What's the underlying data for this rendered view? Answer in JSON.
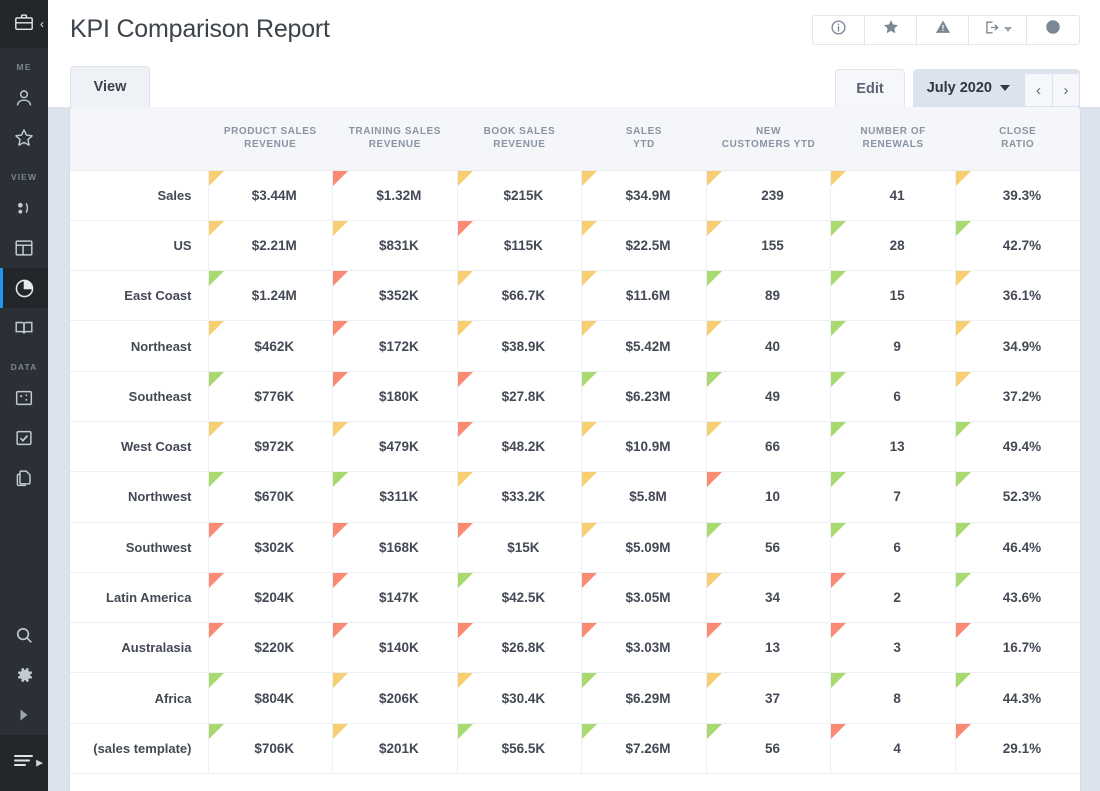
{
  "sidebar": {
    "logo_icon": "briefcase-icon",
    "collapse_icon": "chevron-left-icon",
    "sections": [
      {
        "label": "ME",
        "items": [
          {
            "icon": "user-icon",
            "name": "sidebar-item-profile"
          },
          {
            "icon": "star-icon",
            "name": "sidebar-item-favorites"
          }
        ]
      },
      {
        "label": "VIEW",
        "items": [
          {
            "icon": "people-icon",
            "name": "sidebar-item-people"
          },
          {
            "icon": "dashboard-icon",
            "name": "sidebar-item-dashboard"
          },
          {
            "icon": "pie-chart-icon",
            "name": "sidebar-item-reports",
            "active": true
          },
          {
            "icon": "book-icon",
            "name": "sidebar-item-library"
          }
        ]
      },
      {
        "label": "DATA",
        "items": [
          {
            "icon": "grid-dots-icon",
            "name": "sidebar-item-datasets"
          },
          {
            "icon": "checkbox-icon",
            "name": "sidebar-item-tasks"
          },
          {
            "icon": "copy-icon",
            "name": "sidebar-item-files"
          }
        ]
      }
    ],
    "footer_items": [
      {
        "icon": "search-icon",
        "name": "sidebar-item-search"
      },
      {
        "icon": "gear-icon",
        "name": "sidebar-item-settings"
      },
      {
        "icon": "play-icon",
        "name": "sidebar-item-expand"
      }
    ],
    "bottom_bar": {
      "icon": "menu-lines-icon",
      "arrow_icon": "triangle-right-icon"
    }
  },
  "header": {
    "title": "KPI Comparison Report",
    "toolbar": [
      {
        "name": "info-icon",
        "label": "Info"
      },
      {
        "name": "star-icon",
        "label": "Favorite"
      },
      {
        "name": "warning-icon",
        "label": "Alerts"
      },
      {
        "name": "export-icon",
        "label": "Export",
        "has_caret": true
      },
      {
        "name": "clock-icon",
        "label": "History"
      }
    ]
  },
  "tabs": {
    "view_label": "View",
    "edit_label": "Edit",
    "period_label": "July 2020",
    "prev_label": "‹",
    "next_label": "›"
  },
  "table": {
    "row_header_label": "",
    "columns": [
      "PRODUCT SALES REVENUE",
      "TRAINING SALES REVENUE",
      "BOOK SALES REVENUE",
      "SALES YTD",
      "NEW CUSTOMERS YTD",
      "NUMBER OF RENEWALS",
      "CLOSE RATIO"
    ],
    "column_lines": [
      [
        "PRODUCT SALES",
        "REVENUE"
      ],
      [
        "TRAINING SALES",
        "REVENUE"
      ],
      [
        "BOOK SALES",
        "REVENUE"
      ],
      [
        "SALES",
        "YTD"
      ],
      [
        "NEW",
        "CUSTOMERS YTD"
      ],
      [
        "NUMBER OF",
        "RENEWALS"
      ],
      [
        "CLOSE",
        "RATIO"
      ]
    ],
    "rows": [
      {
        "label": "Sales",
        "cells": [
          {
            "value": "$3.44M",
            "status": "yellow"
          },
          {
            "value": "$1.32M",
            "status": "red"
          },
          {
            "value": "$215K",
            "status": "yellow"
          },
          {
            "value": "$34.9M",
            "status": "yellow"
          },
          {
            "value": "239",
            "status": "yellow"
          },
          {
            "value": "41",
            "status": "yellow"
          },
          {
            "value": "39.3%",
            "status": "yellow"
          }
        ]
      },
      {
        "label": "US",
        "cells": [
          {
            "value": "$2.21M",
            "status": "yellow"
          },
          {
            "value": "$831K",
            "status": "yellow"
          },
          {
            "value": "$115K",
            "status": "red"
          },
          {
            "value": "$22.5M",
            "status": "yellow"
          },
          {
            "value": "155",
            "status": "yellow"
          },
          {
            "value": "28",
            "status": "green"
          },
          {
            "value": "42.7%",
            "status": "green"
          }
        ]
      },
      {
        "label": "East Coast",
        "cells": [
          {
            "value": "$1.24M",
            "status": "green"
          },
          {
            "value": "$352K",
            "status": "red"
          },
          {
            "value": "$66.7K",
            "status": "yellow"
          },
          {
            "value": "$11.6M",
            "status": "yellow"
          },
          {
            "value": "89",
            "status": "green"
          },
          {
            "value": "15",
            "status": "green"
          },
          {
            "value": "36.1%",
            "status": "yellow"
          }
        ]
      },
      {
        "label": "Northeast",
        "cells": [
          {
            "value": "$462K",
            "status": "yellow"
          },
          {
            "value": "$172K",
            "status": "red"
          },
          {
            "value": "$38.9K",
            "status": "yellow"
          },
          {
            "value": "$5.42M",
            "status": "yellow"
          },
          {
            "value": "40",
            "status": "yellow"
          },
          {
            "value": "9",
            "status": "green"
          },
          {
            "value": "34.9%",
            "status": "yellow"
          }
        ]
      },
      {
        "label": "Southeast",
        "cells": [
          {
            "value": "$776K",
            "status": "green"
          },
          {
            "value": "$180K",
            "status": "red"
          },
          {
            "value": "$27.8K",
            "status": "red"
          },
          {
            "value": "$6.23M",
            "status": "green"
          },
          {
            "value": "49",
            "status": "green"
          },
          {
            "value": "6",
            "status": "green"
          },
          {
            "value": "37.2%",
            "status": "yellow"
          }
        ]
      },
      {
        "label": "West Coast",
        "cells": [
          {
            "value": "$972K",
            "status": "yellow"
          },
          {
            "value": "$479K",
            "status": "yellow"
          },
          {
            "value": "$48.2K",
            "status": "red"
          },
          {
            "value": "$10.9M",
            "status": "yellow"
          },
          {
            "value": "66",
            "status": "yellow"
          },
          {
            "value": "13",
            "status": "green"
          },
          {
            "value": "49.4%",
            "status": "green"
          }
        ]
      },
      {
        "label": "Northwest",
        "cells": [
          {
            "value": "$670K",
            "status": "green"
          },
          {
            "value": "$311K",
            "status": "green"
          },
          {
            "value": "$33.2K",
            "status": "yellow"
          },
          {
            "value": "$5.8M",
            "status": "yellow"
          },
          {
            "value": "10",
            "status": "red"
          },
          {
            "value": "7",
            "status": "green"
          },
          {
            "value": "52.3%",
            "status": "green"
          }
        ]
      },
      {
        "label": "Southwest",
        "cells": [
          {
            "value": "$302K",
            "status": "red"
          },
          {
            "value": "$168K",
            "status": "red"
          },
          {
            "value": "$15K",
            "status": "red"
          },
          {
            "value": "$5.09M",
            "status": "yellow"
          },
          {
            "value": "56",
            "status": "green"
          },
          {
            "value": "6",
            "status": "green"
          },
          {
            "value": "46.4%",
            "status": "green"
          }
        ]
      },
      {
        "label": "Latin America",
        "cells": [
          {
            "value": "$204K",
            "status": "red"
          },
          {
            "value": "$147K",
            "status": "red"
          },
          {
            "value": "$42.5K",
            "status": "green"
          },
          {
            "value": "$3.05M",
            "status": "red"
          },
          {
            "value": "34",
            "status": "yellow"
          },
          {
            "value": "2",
            "status": "red"
          },
          {
            "value": "43.6%",
            "status": "green"
          }
        ]
      },
      {
        "label": "Australasia",
        "cells": [
          {
            "value": "$220K",
            "status": "red"
          },
          {
            "value": "$140K",
            "status": "red"
          },
          {
            "value": "$26.8K",
            "status": "red"
          },
          {
            "value": "$3.03M",
            "status": "red"
          },
          {
            "value": "13",
            "status": "red"
          },
          {
            "value": "3",
            "status": "red"
          },
          {
            "value": "16.7%",
            "status": "red"
          }
        ]
      },
      {
        "label": "Africa",
        "cells": [
          {
            "value": "$804K",
            "status": "green"
          },
          {
            "value": "$206K",
            "status": "yellow"
          },
          {
            "value": "$30.4K",
            "status": "yellow"
          },
          {
            "value": "$6.29M",
            "status": "green"
          },
          {
            "value": "37",
            "status": "yellow"
          },
          {
            "value": "8",
            "status": "green"
          },
          {
            "value": "44.3%",
            "status": "green"
          }
        ]
      },
      {
        "label": "(sales template)",
        "cells": [
          {
            "value": "$706K",
            "status": "green"
          },
          {
            "value": "$201K",
            "status": "yellow"
          },
          {
            "value": "$56.5K",
            "status": "green"
          },
          {
            "value": "$7.26M",
            "status": "green"
          },
          {
            "value": "56",
            "status": "green"
          },
          {
            "value": "4",
            "status": "red"
          },
          {
            "value": "29.1%",
            "status": "red"
          }
        ]
      }
    ]
  },
  "colors": {
    "status_green": "#a8da70",
    "status_yellow": "#f8ce72",
    "status_red": "#fa8a72",
    "sidebar_bg": "#2b3036",
    "accent_blue": "#2196f3",
    "page_bg": "#dde3ec"
  }
}
